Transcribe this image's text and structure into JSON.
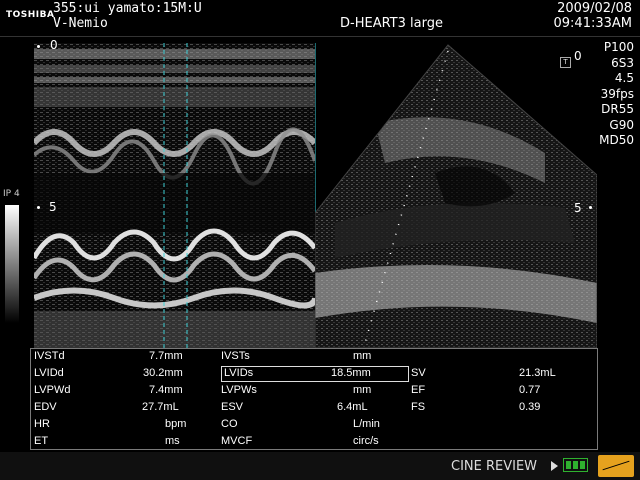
{
  "header": {
    "logo": "TOSHIBA",
    "patient_line1": "355:ui yamato:15M:U",
    "patient_line2": "V-Nemio",
    "probe": "D-HEART3 large",
    "date": "2009/02/08",
    "time": "09:41:33AM"
  },
  "depth_marks": {
    "top": "0",
    "mid": "5",
    "sector_top": "0",
    "sector_mid": "5"
  },
  "params": [
    "P100",
    "6S3",
    "4.5",
    "39fps",
    "DR55",
    "G90",
    "MD50"
  ],
  "gray_scale_label": "IP 4",
  "t_icon": "T",
  "measurements": [
    [
      {
        "label": "IVSTd",
        "value": "7.7mm"
      },
      {
        "label": "IVSTs",
        "value": "mm"
      },
      {
        "label": "",
        "value": ""
      }
    ],
    [
      {
        "label": "LVIDd",
        "value": "30.2mm"
      },
      {
        "label": "LVIDs",
        "value": "18.5mm"
      },
      {
        "label": "SV",
        "value": "21.3mL"
      }
    ],
    [
      {
        "label": "LVPWd",
        "value": "7.4mm"
      },
      {
        "label": "LVPWs",
        "value": "mm"
      },
      {
        "label": "EF",
        "value": "0.77"
      }
    ],
    [
      {
        "label": "EDV",
        "value": "27.7mL"
      },
      {
        "label": "ESV",
        "value": "6.4mL"
      },
      {
        "label": "FS",
        "value": "0.39"
      }
    ],
    [
      {
        "label": "HR",
        "value": "bpm"
      },
      {
        "label": "CO",
        "value": "L/min"
      },
      {
        "label": "",
        "value": ""
      }
    ],
    [
      {
        "label": "ET",
        "value": "ms"
      },
      {
        "label": "MVCF",
        "value": "circ/s"
      },
      {
        "label": "",
        "value": ""
      }
    ]
  ],
  "footer": {
    "cine_label": "CINE REVIEW"
  },
  "colors": {
    "caliper_line": "#3fd0d6",
    "highlight_box": "#dddddd",
    "frames_icon": "#2fb22f",
    "caliper_button": "#e6a21e"
  }
}
